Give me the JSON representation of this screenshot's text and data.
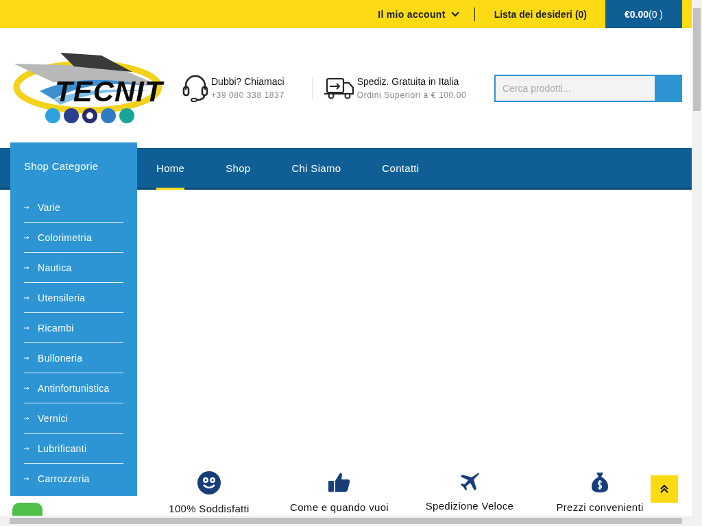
{
  "top_bar": {
    "account_menu": "Il mio account",
    "wishlist": "Lista dei desideri (0)",
    "cart": {
      "total": "€0.00",
      "count": "(0 )"
    }
  },
  "header": {
    "logo_text": "TECNIT",
    "contacts": [
      {
        "kind": "phone",
        "title": "Dubbi? Chiamaci",
        "subtitle": "+39 080 338 1837"
      },
      {
        "kind": "truck",
        "title": "Spediz. Gratuita in Italia",
        "subtitle": "Ordini Superiori a € 100,00"
      }
    ],
    "search": {
      "placeholder": "Cerca prodotti..."
    }
  },
  "categories": {
    "title": "Shop Categorie",
    "items": [
      "Varie",
      "Colorimetria",
      "Nautica",
      "Utensileria",
      "Ricambi",
      "Bulloneria",
      "Antinfortunistica",
      "Vernici",
      "Lubrificanti",
      "Carrozzeria"
    ]
  },
  "nav": [
    {
      "label": "Home",
      "selected": true
    },
    {
      "label": "Shop",
      "selected": false
    },
    {
      "label": "Chi Siamo",
      "selected": false
    },
    {
      "label": "Contatti",
      "selected": false
    }
  ],
  "features": [
    {
      "kind": "smile",
      "label": "100% Soddisfatti"
    },
    {
      "kind": "thumb",
      "label": "Come e quando vuoi"
    },
    {
      "kind": "plane",
      "label": "Spedizione Veloce"
    },
    {
      "kind": "money",
      "label": "Prezzi convenienti"
    }
  ]
}
